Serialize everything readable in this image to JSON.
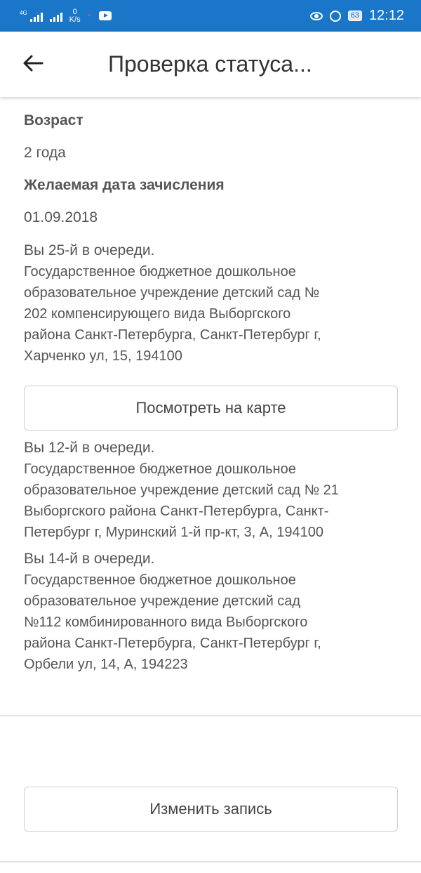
{
  "status_bar": {
    "network": "4G",
    "speed_value": "0",
    "speed_unit": "K/s",
    "battery": "63",
    "time": "12:12"
  },
  "app_bar": {
    "title": "Проверка статуса...",
    "back_icon": "arrow-left-icon"
  },
  "details": {
    "age_label": "Возраст",
    "age_value": "2 года",
    "date_label": "Желаемая дата зачисления",
    "date_value": "01.09.2018"
  },
  "queues": [
    {
      "position": "Вы 25-й в очереди.",
      "lines": [
        "Государственное бюджетное дошкольное",
        "образовательное учреждение детский сад №",
        "202 компенсирующего вида Выборгского",
        "района Санкт-Петербурга, Санкт-Петербург г,",
        "Харченко ул, 15, 194100"
      ]
    },
    {
      "position": "Вы 12-й в очереди.",
      "lines": [
        "Государственное бюджетное дошкольное",
        "образовательное учреждение детский сад № 21",
        "Выборгского района Санкт-Петербурга, Санкт-",
        "Петербург г, Муринский 1-й пр-кт, 3, А, 194100"
      ]
    },
    {
      "position": "Вы 14-й в очереди.",
      "lines": [
        "Государственное бюджетное дошкольное",
        "образовательное учреждение детский сад",
        "№112 комбинированного вида Выборгского",
        "района Санкт-Петербурга, Санкт-Петербург г,",
        "Орбели ул, 14, А, 194223"
      ]
    }
  ],
  "buttons": {
    "map": "Посмотреть на карте",
    "edit": "Изменить запись"
  },
  "colors": {
    "status_bar": "#1976c8"
  }
}
